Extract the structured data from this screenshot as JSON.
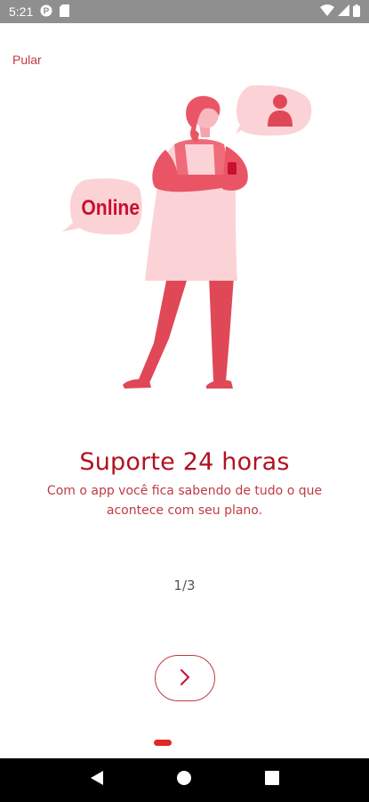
{
  "status_bar": {
    "time": "5:21",
    "icons": [
      "app-notification-icon",
      "sd-card-icon",
      "wifi-icon",
      "signal-icon",
      "battery-icon"
    ]
  },
  "skip_label": "Pular",
  "illustration": {
    "bubble_left_text": "Online",
    "bubble_right_icon": "person-icon"
  },
  "slide": {
    "title": "Suporte 24 horas",
    "subtitle": "Com o app você fica sabendo de tudo o que acontece com seu plano."
  },
  "pagination": {
    "text": "1/3",
    "current": 1,
    "total": 3
  },
  "next_button": {
    "icon": "chevron-right-icon"
  },
  "nav_bar": {
    "icons": [
      "back-icon",
      "home-icon",
      "recents-icon"
    ]
  },
  "colors": {
    "brand": "#b2121f",
    "accent": "#e02626",
    "text_secondary": "#c23a44",
    "pink_light": "#fbd3d7"
  }
}
